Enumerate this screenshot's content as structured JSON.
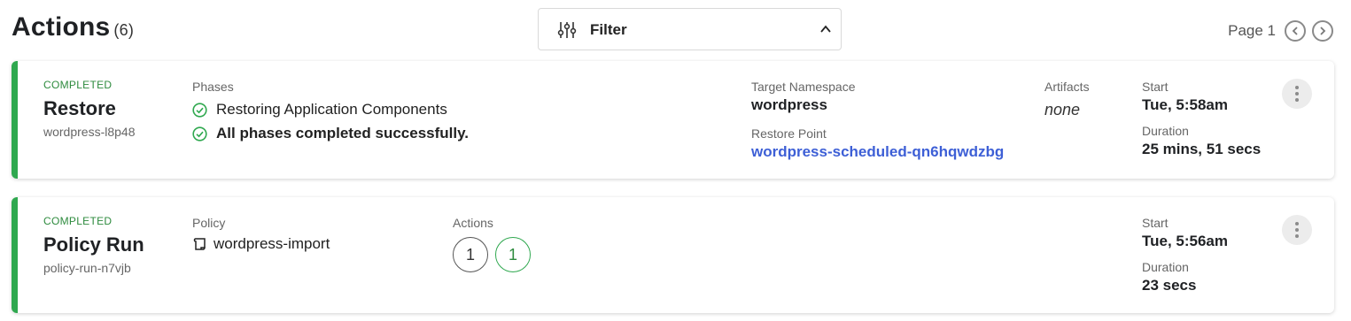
{
  "header": {
    "title": "Actions",
    "count": "(6)",
    "filter": {
      "label": "Filter",
      "icon": "sliders-icon",
      "expanded_icon": "chevron-up-icon"
    },
    "pager": {
      "label": "Page 1",
      "prev_icon": "chevron-left-icon",
      "next_icon": "chevron-right-icon"
    }
  },
  "colors": {
    "status_bar": "#2fa84f",
    "status_text": "#2e8b3e",
    "link": "#3d5fd6"
  },
  "cards": [
    {
      "status": "COMPLETED",
      "title": "Restore",
      "subtitle": "wordpress-l8p48",
      "phases_label": "Phases",
      "phases": [
        {
          "text": "Restoring Application Components",
          "icon": "check-circle-icon"
        },
        {
          "text": "All phases completed successfully.",
          "icon": "check-circle-icon"
        }
      ],
      "target_namespace_label": "Target Namespace",
      "target_namespace": "wordpress",
      "restore_point_label": "Restore Point",
      "restore_point": "wordpress-scheduled-qn6hqwdzbg",
      "artifacts_label": "Artifacts",
      "artifacts": "none",
      "start_label": "Start",
      "start": "Tue, 5:58am",
      "duration_label": "Duration",
      "duration": "25 mins, 51 secs",
      "menu_icon": "kebab-menu-icon"
    },
    {
      "status": "COMPLETED",
      "title": "Policy Run",
      "subtitle": "policy-run-n7vjb",
      "policy_label": "Policy",
      "policy": "wordpress-import",
      "policy_icon": "scroll-icon",
      "actions_label": "Actions",
      "actions_counts": [
        "1",
        "1"
      ],
      "start_label": "Start",
      "start": "Tue, 5:56am",
      "duration_label": "Duration",
      "duration": "23 secs",
      "menu_icon": "kebab-menu-icon"
    }
  ]
}
